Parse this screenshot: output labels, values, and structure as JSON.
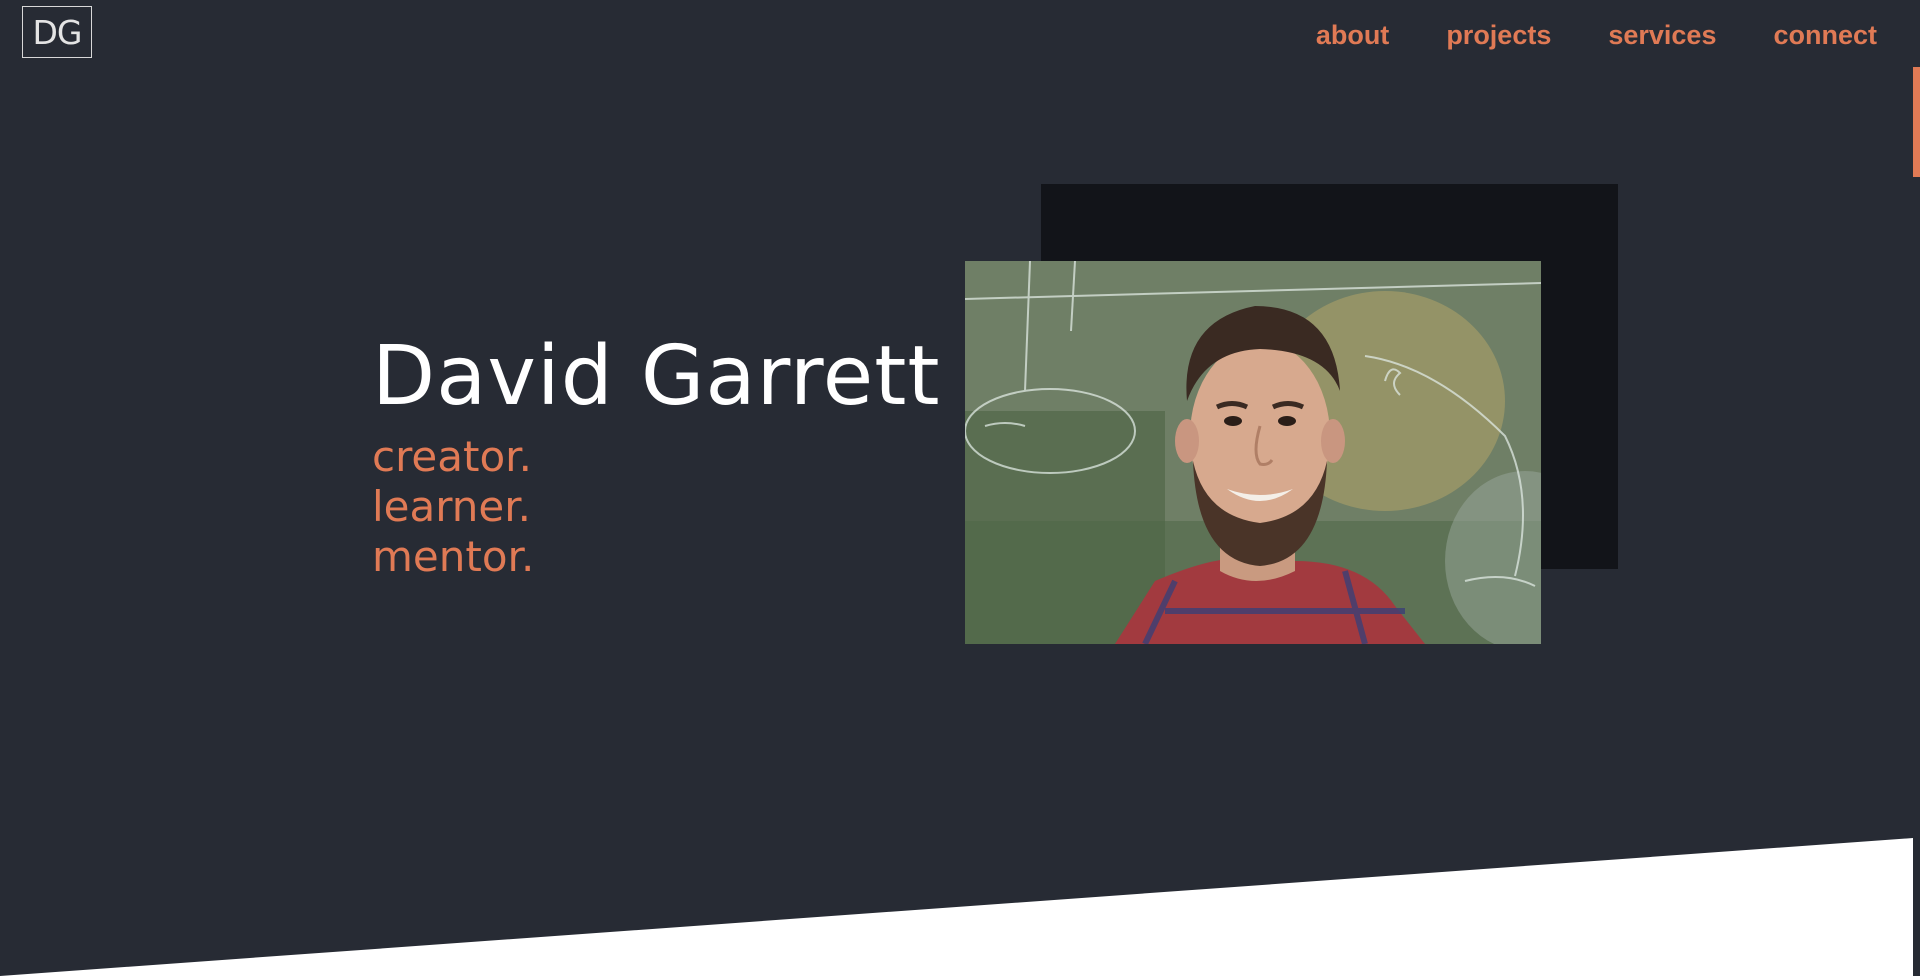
{
  "brand": {
    "logo_text": "DG"
  },
  "nav": {
    "items": [
      {
        "label": "about"
      },
      {
        "label": "projects"
      },
      {
        "label": "services"
      },
      {
        "label": "connect"
      }
    ]
  },
  "hero": {
    "name": "David Garrett",
    "taglines": [
      "creator.",
      "learner.",
      "mentor."
    ]
  },
  "colors": {
    "background": "#272b34",
    "accent": "#e07a55",
    "text": "#ffffff",
    "shadow_block": "#121419"
  }
}
